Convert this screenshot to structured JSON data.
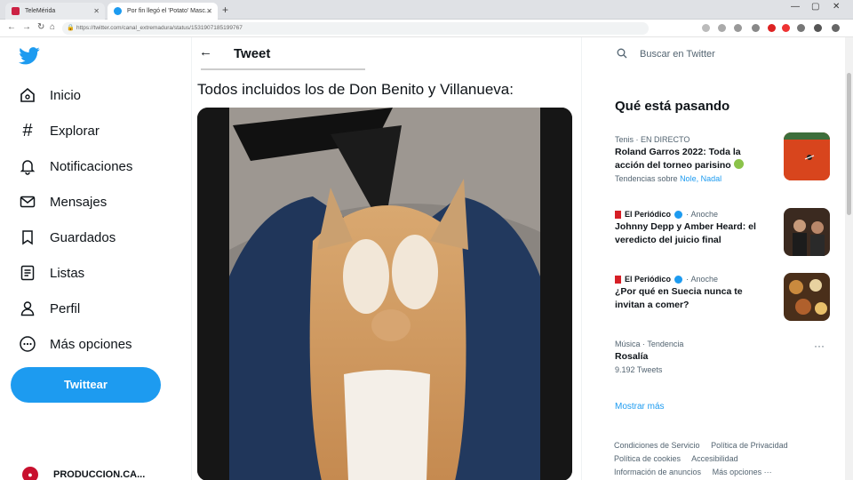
{
  "browser": {
    "tabs": [
      {
        "title": "TeleMérida",
        "active": false
      },
      {
        "title": "Por fin llegó el 'Potato' Masc...",
        "active": true
      }
    ],
    "url": "https://twitter.com/canal_extremadura/status/1531907185199767"
  },
  "nav": {
    "items": [
      {
        "label": "Inicio",
        "icon": "home-icon"
      },
      {
        "label": "Explorar",
        "icon": "hashtag-icon"
      },
      {
        "label": "Notificaciones",
        "icon": "bell-icon"
      },
      {
        "label": "Mensajes",
        "icon": "envelope-icon"
      },
      {
        "label": "Guardados",
        "icon": "bookmark-icon"
      },
      {
        "label": "Listas",
        "icon": "list-icon"
      },
      {
        "label": "Perfil",
        "icon": "person-icon"
      },
      {
        "label": "Más opciones",
        "icon": "more-circle-icon"
      }
    ],
    "tweet_button": "Twittear",
    "profile_name": "PRODUCCION.CA..."
  },
  "main": {
    "title": "Tweet",
    "text": "Todos incluidos los de Don Benito y Villanueva:"
  },
  "right": {
    "search_placeholder": "Buscar en Twitter",
    "trends_title": "Qué está pasando",
    "trends": [
      {
        "meta": "Tenis · EN DIRECTO",
        "headline": "Roland Garros 2022: Toda la acción del torneo parisino",
        "sub_prefix": "Tendencias sobre",
        "sub_links": "Nole, Nadal"
      },
      {
        "source": "El Periódico",
        "time": "Anoche",
        "headline": "Johnny Depp y Amber Heard: el veredicto del juicio final"
      },
      {
        "source": "El Periódico",
        "time": "Anoche",
        "headline": "¿Por qué en Suecia nunca te invitan a comer?"
      },
      {
        "meta": "Música · Tendencia",
        "headline": "Rosalía",
        "count": "9.192 Tweets"
      }
    ],
    "show_more": "Mostrar más",
    "footer": [
      "Condiciones de Servicio",
      "Política de Privacidad",
      "Política de cookies",
      "Accesibilidad",
      "Información de anuncios",
      "Más opciones ···"
    ]
  },
  "colors": {
    "accent": "#1d9bf0",
    "text": "#0f1419",
    "muted": "#536471"
  }
}
